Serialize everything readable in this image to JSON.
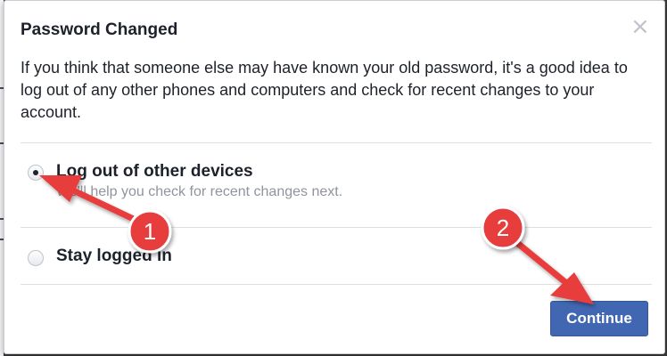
{
  "dialog": {
    "title": "Password Changed",
    "close_symbol": "×",
    "message": "If you think that someone else may have known your old password, it's a good idea to log out of any other phones and computers and check for recent changes to your account.",
    "options": [
      {
        "label": "Log out of other devices",
        "hint": "We'll help you check for recent changes next.",
        "selected": true
      },
      {
        "label": "Stay logged in",
        "selected": false
      }
    ],
    "continue_label": "Continue"
  },
  "annotations": [
    {
      "number": "1",
      "color": "#e83e3e"
    },
    {
      "number": "2",
      "color": "#e83e3e"
    }
  ],
  "colors": {
    "primary_button": "#4267b2",
    "annotation_red": "#e83e3e",
    "text": "#1d2129",
    "hint_text": "#90949c"
  }
}
